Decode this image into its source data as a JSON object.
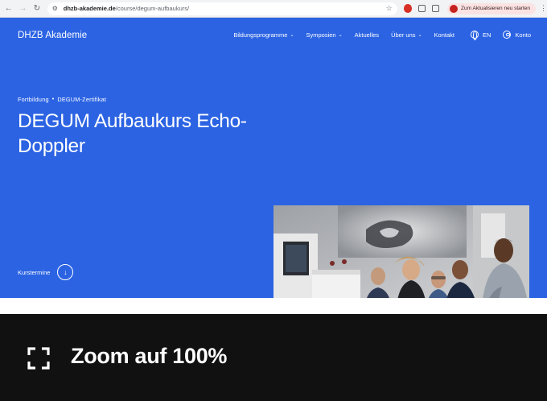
{
  "browser": {
    "back_icon": "arrow-left-icon",
    "forward_icon": "arrow-right-icon",
    "reload_icon": "reload-icon",
    "url_host": "dhzb-akademie.de",
    "url_path": "/course/degum-aufbaukurs/",
    "update_label": "Zum Aktualisieren neu starten"
  },
  "site": {
    "logo": "DHZB Akademie",
    "nav": {
      "bildungsprogramme": "Bildungsprogramme",
      "symposien": "Symposien",
      "aktuelles": "Aktuelles",
      "ueber_uns": "Über uns",
      "kontakt": "Kontakt",
      "language": "EN",
      "account": "Konto"
    },
    "breadcrumb": {
      "first": "Fortbildung",
      "separator": "•",
      "second": "DEGUM-Zertifikat"
    },
    "title": "DEGUM Aufbaukurs Echo-Doppler",
    "kurstermine": "Kurstermine",
    "accent_color": "#2b63e3"
  },
  "overlay": {
    "icon": "fullscreen-icon",
    "text": "Zoom auf 100%"
  }
}
